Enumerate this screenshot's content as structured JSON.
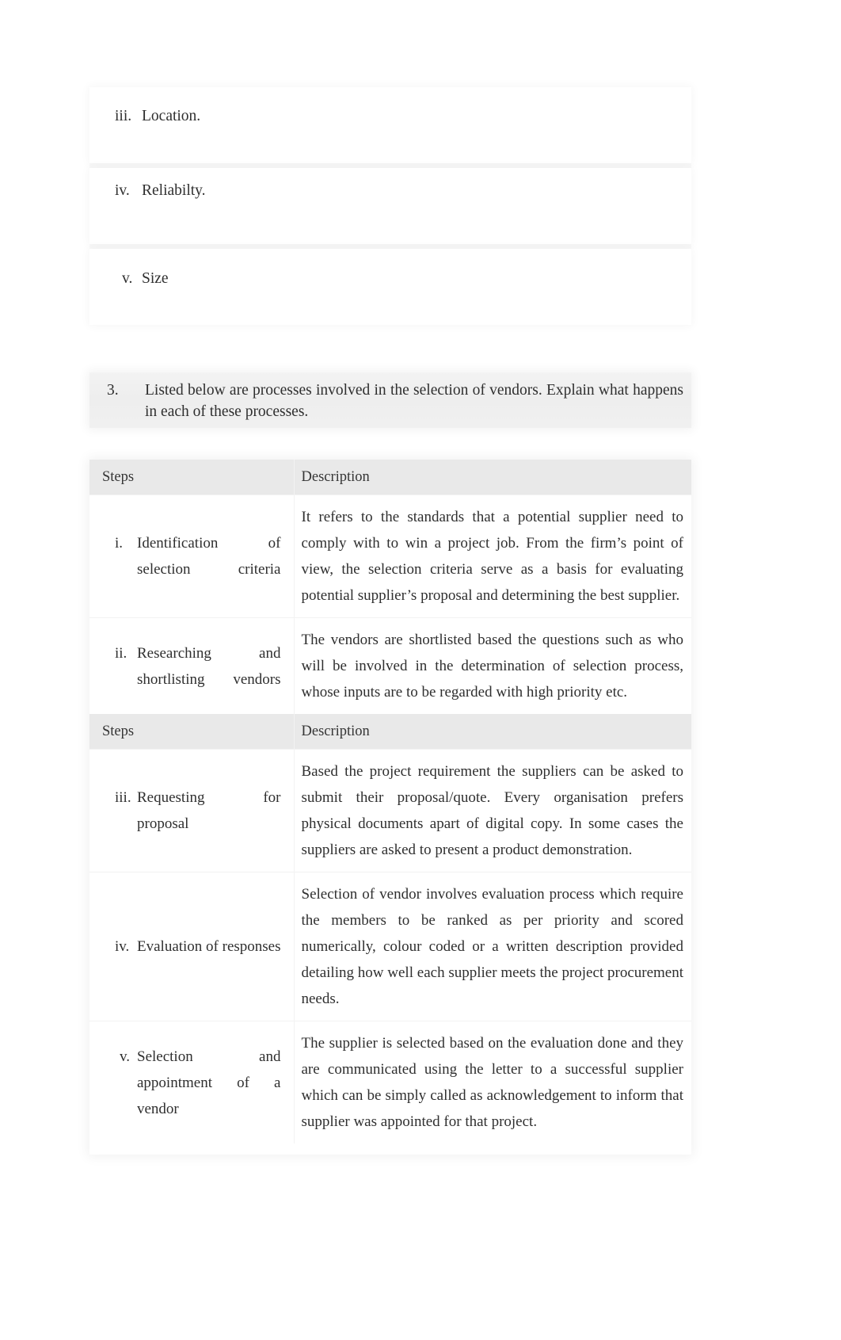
{
  "top_list": {
    "items": [
      {
        "numeral": "iii.",
        "text": "Location."
      },
      {
        "numeral": "iv.",
        "text": "Reliabilty."
      },
      {
        "numeral": "v.",
        "text": "Size"
      }
    ]
  },
  "question": {
    "number": "3.",
    "text": "Listed below are processes involved in the selection of vendors. Explain what happens in each of these processes."
  },
  "table": {
    "header_steps": "Steps",
    "header_description": "Description",
    "rows": [
      {
        "numeral": "i.",
        "step": "Identification of selection criteria",
        "description": "It refers to the standards that a potential supplier need to comply with to win a project job. From the firm’s point of view, the selection criteria serve as a basis for evaluating potential supplier’s proposal and determining the best supplier."
      },
      {
        "numeral": "ii.",
        "step": "Researching and shortlisting vendors",
        "description": "The vendors are shortlisted based the   questions such as who will be involved in the determination of selection process, whose inputs are to be regarded with high priority etc."
      },
      {
        "numeral": "iii.",
        "step": "Requesting for proposal",
        "description": "Based the project requirement the suppliers can be asked to submit their proposal/quote.   Every organisation prefers physical documents apart of digital copy. In some cases the suppliers are asked to present a product demonstration."
      },
      {
        "numeral": "iv.",
        "step": "Evaluation of responses",
        "description": "Selection of vendor involves evaluation process which require the members to be ranked as per priority and scored numerically, colour coded or a written description provided detailing how well each supplier meets the project procurement needs."
      },
      {
        "numeral": "v.",
        "step": "Selection and appointment of a vendor",
        "description": "The supplier is selected based on the evaluation done and they are communicated using the letter to a successful supplier which can be simply called as acknowledgement to inform that supplier was appointed for that project."
      }
    ]
  },
  "colors": {
    "page_background": "#ffffff",
    "header_row_background": "#e9e9e9",
    "question_background": "#efefef",
    "text": "#2f2f2f"
  }
}
